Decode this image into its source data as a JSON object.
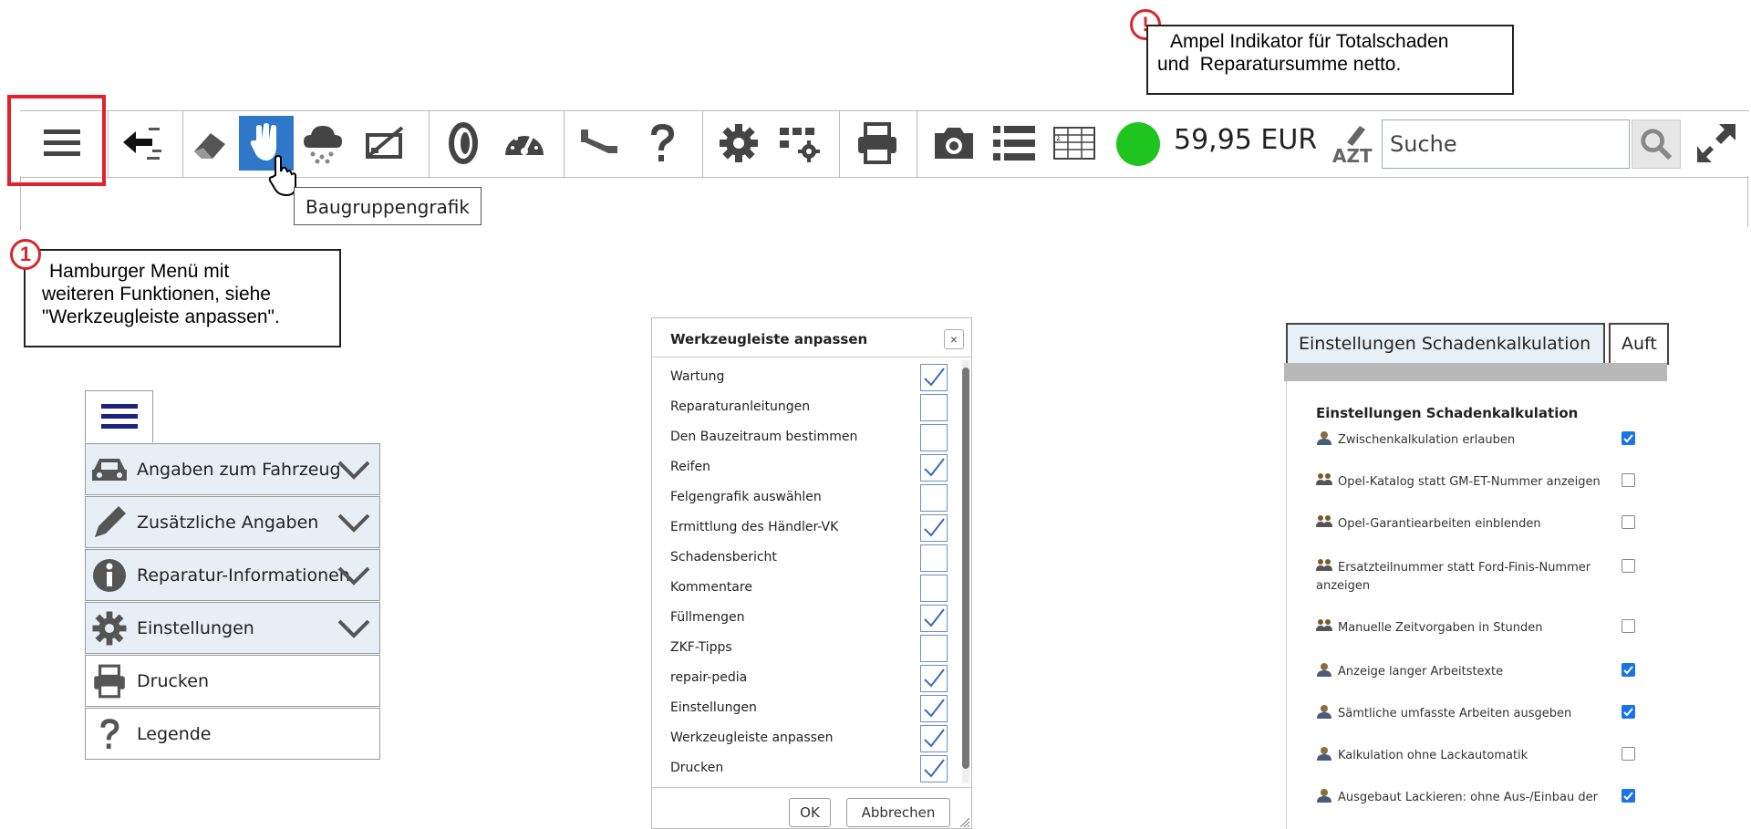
{
  "toolbar": {
    "amount": "59,95 EUR",
    "search_placeholder": "Suche",
    "tooltip": "Baugruppengrafik",
    "status_color": "#1fc41f",
    "active_color": "#2f77c9",
    "icons": [
      "hamburger-menu-icon",
      "back-arrow-icon",
      "eraser-icon",
      "hand-pointer-icon",
      "hail-cloud-icon",
      "car-damage-icon",
      "tire-icon",
      "speedometer-icon",
      "paint-gun-icon",
      "question-icon",
      "gear-icon",
      "grid-settings-icon",
      "printer-icon",
      "camera-icon",
      "list-icon",
      "sum-table-icon",
      "status-light-icon",
      "azt-icon",
      "search-icon",
      "expand-icon"
    ]
  },
  "callouts": {
    "ampel_badge": "!",
    "ampel_text_line1": "Ampel Indikator für Totalschaden",
    "ampel_text_line2": "und  Reparatursumme netto.",
    "menu_badge": "1",
    "menu_text_line1": "Hamburger Menü mit",
    "menu_text_line2": "weiteren Funktionen, siehe",
    "menu_text_line3": "\"Werkzeugleiste anpassen\"."
  },
  "hamburger_menu": {
    "items": [
      {
        "label": "Angaben zum Fahrzeug",
        "icon": "car-icon",
        "expandable": true
      },
      {
        "label": "Zusätzliche Angaben",
        "icon": "pencil-icon",
        "expandable": true
      },
      {
        "label": "Reparatur-Informationen",
        "icon": "info-icon",
        "expandable": true
      },
      {
        "label": "Einstellungen",
        "icon": "gear-icon",
        "expandable": true
      },
      {
        "label": "Drucken",
        "icon": "printer-icon",
        "expandable": false
      },
      {
        "label": "Legende",
        "icon": "question-icon",
        "expandable": false
      }
    ]
  },
  "dialog": {
    "title": "Werkzeugleiste anpassen",
    "close": "×",
    "items": [
      {
        "label": "Wartung",
        "checked": true
      },
      {
        "label": "Reparaturanleitungen",
        "checked": false
      },
      {
        "label": "Den Bauzeitraum bestimmen",
        "checked": false
      },
      {
        "label": "Reifen",
        "checked": true
      },
      {
        "label": "Felgengrafik auswählen",
        "checked": false
      },
      {
        "label": "Ermittlung des Händler-VK",
        "checked": true
      },
      {
        "label": "Schadensbericht",
        "checked": false
      },
      {
        "label": "Kommentare",
        "checked": false
      },
      {
        "label": "Füllmengen",
        "checked": true
      },
      {
        "label": "ZKF-Tipps",
        "checked": false
      },
      {
        "label": "repair-pedia",
        "checked": true
      },
      {
        "label": "Einstellungen",
        "checked": true
      },
      {
        "label": "Werkzeugleiste anpassen",
        "checked": true
      },
      {
        "label": "Drucken",
        "checked": true
      }
    ],
    "ok": "OK",
    "cancel": "Abbrechen"
  },
  "settings": {
    "tab_active": "Einstellungen Schadenkalkulation",
    "tab_next": "Auft",
    "title": "Einstellungen Schadenkalkulation",
    "rows": [
      {
        "label": "Zwischenkalkulation erlauben",
        "icon": "user-icon",
        "checked": true
      },
      {
        "label": "Opel-Katalog statt GM-ET-Nummer anzeigen",
        "icon": "group-icon",
        "checked": false
      },
      {
        "label": "Opel-Garantiearbeiten einblenden",
        "icon": "group-icon",
        "checked": false
      },
      {
        "label": "Ersatzteilnummer statt Ford-Finis-Nummer",
        "label2": "anzeigen",
        "icon": "group-icon",
        "checked": false
      },
      {
        "label": "Manuelle Zeitvorgaben in Stunden",
        "icon": "group-icon",
        "checked": false
      },
      {
        "label": "Anzeige langer Arbeitstexte",
        "icon": "user-icon",
        "checked": true
      },
      {
        "label": "Sämtliche umfasste Arbeiten ausgeben",
        "icon": "user-icon",
        "checked": true
      },
      {
        "label": "Kalkulation ohne Lackautomatik",
        "icon": "user-icon",
        "checked": false
      },
      {
        "label": "Ausgebaut Lackieren: ohne Aus-/Einbau der",
        "icon": "user-icon",
        "checked": true
      }
    ]
  }
}
